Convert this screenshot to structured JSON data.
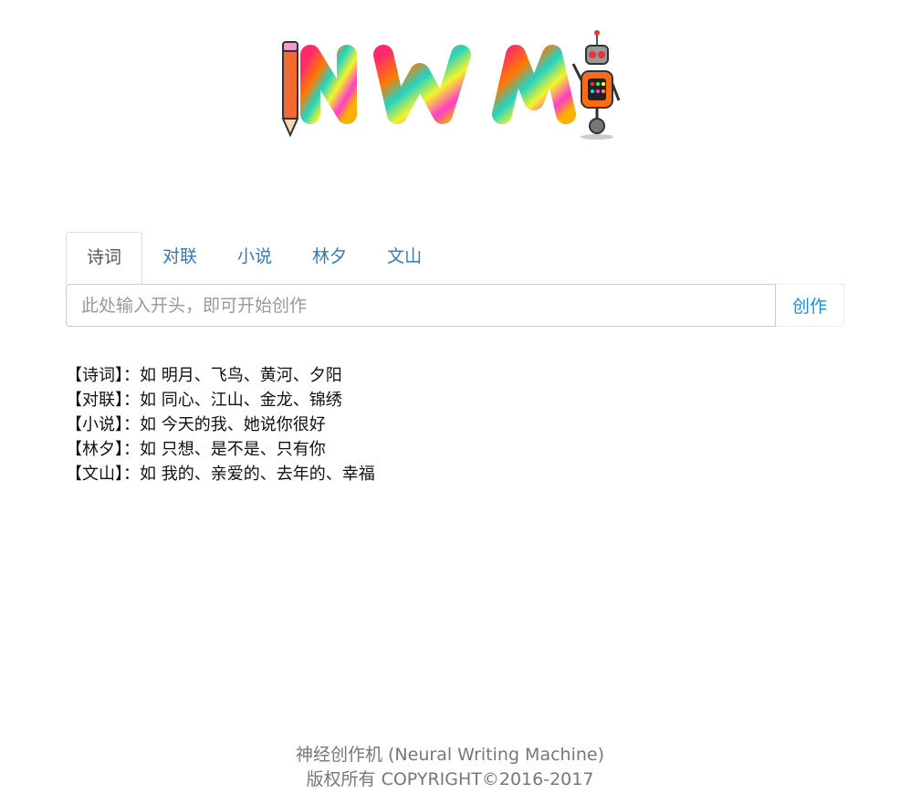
{
  "logo": {
    "letters": "NWM"
  },
  "tabs": [
    {
      "label": "诗词",
      "active": true
    },
    {
      "label": "对联",
      "active": false
    },
    {
      "label": "小说",
      "active": false
    },
    {
      "label": "林夕",
      "active": false
    },
    {
      "label": "文山",
      "active": false
    }
  ],
  "search": {
    "placeholder": "此处输入开头，即可开始创作",
    "value": "",
    "button_label": "创作"
  },
  "examples": [
    "【诗词】：如 明月、飞鸟、黄河、夕阳",
    "【对联】：如 同心、江山、金龙、锦绣",
    "【小说】：如 今天的我、她说你很好",
    "【林夕】：如 只想、是不是、只有你",
    "【文山】：如 我的、亲爱的、去年的、幸福"
  ],
  "footer": {
    "line1": "神经创作机 (Neural Writing Machine)",
    "line2": "版权所有 COPYRIGHT©2016-2017"
  },
  "colors": {
    "tab_link": "#337ab7",
    "button_text": "#1a8fd8",
    "footer": "#777777"
  }
}
